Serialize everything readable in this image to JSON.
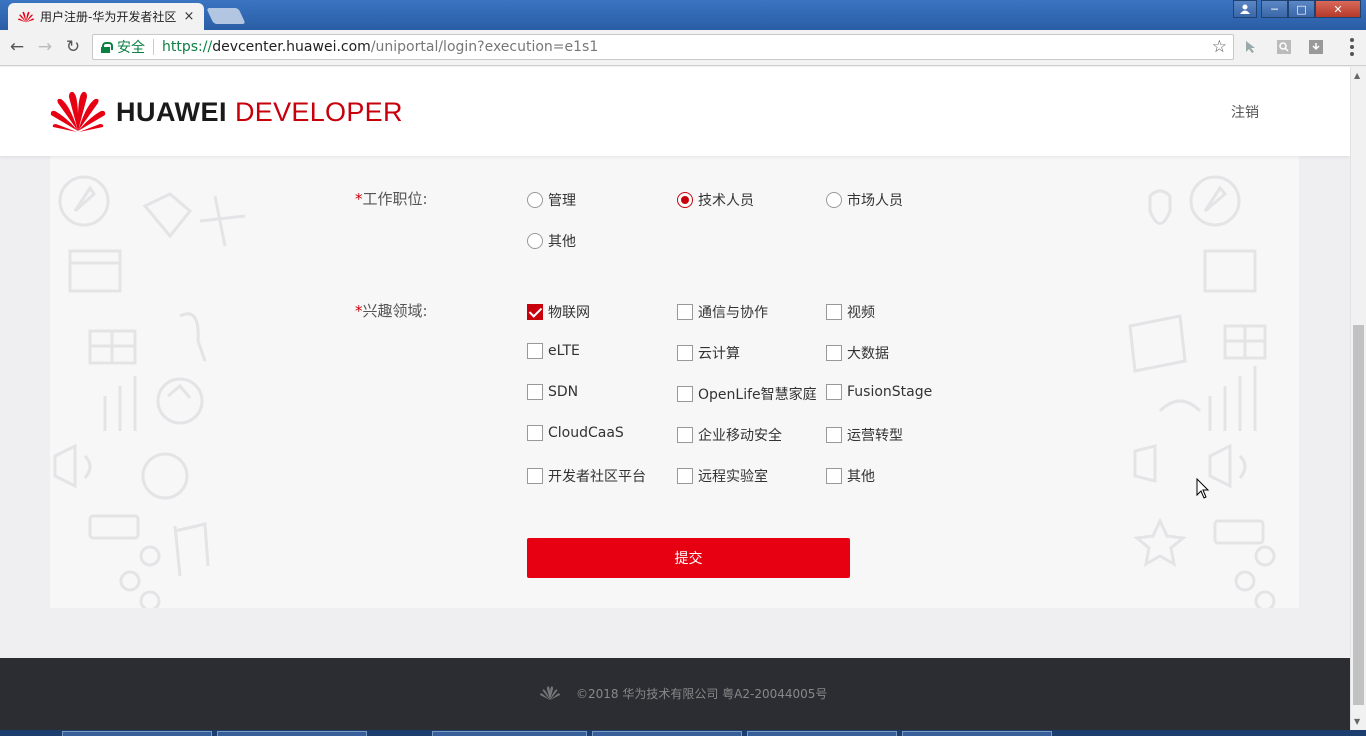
{
  "browser": {
    "tab_title": "用户注册-华为开发者社区",
    "tab_close": "×",
    "window_controls": {
      "minimize": "─",
      "maximize": "□",
      "close": "✕"
    },
    "back": "←",
    "forward": "→",
    "reload": "↻",
    "secure_label": "安全",
    "url_protocol": "https://",
    "url_host": "devcenter.huawei.com",
    "url_path": "/uniportal/login?execution=e1s1",
    "bookmark_star": "☆"
  },
  "header": {
    "logo_brand": "HUAWEI",
    "logo_product": "DEVELOPER",
    "logout": "注销"
  },
  "form": {
    "position": {
      "label": "工作职位:",
      "required_mark": "*",
      "options": [
        "管理",
        "技术人员",
        "市场人员",
        "其他"
      ],
      "selected": "技术人员"
    },
    "interests": {
      "label": "兴趣领域:",
      "required_mark": "*",
      "options": [
        "物联网",
        "通信与协作",
        "视频",
        "eLTE",
        "云计算",
        "大数据",
        "SDN",
        "OpenLife智慧家庭",
        "FusionStage",
        "CloudCaaS",
        "企业移动安全",
        "运营转型",
        "开发者社区平台",
        "远程实验室",
        "其他"
      ],
      "checked": [
        "物联网"
      ]
    },
    "submit_label": "提交"
  },
  "footer": {
    "copyright": "©2018 华为技术有限公司 粤A2-20044005号"
  },
  "colors": {
    "brand_red": "#c7000b",
    "button_red": "#e60012",
    "footer_bg": "#2b2d33"
  }
}
